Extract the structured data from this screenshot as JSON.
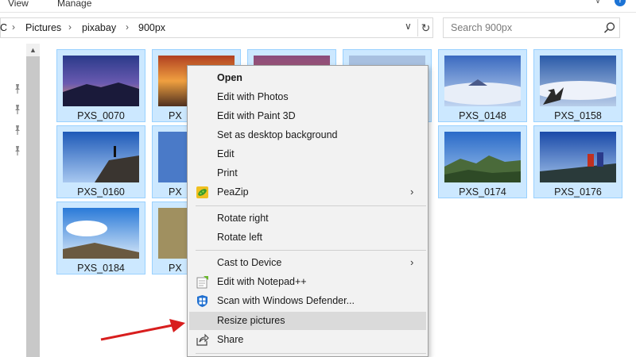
{
  "ribbon": {
    "tabs": [
      "View",
      "Manage"
    ]
  },
  "address": {
    "crumbs": [
      "C",
      "Pictures",
      "pixabay",
      "900px"
    ],
    "separator": "›"
  },
  "search": {
    "placeholder": "Search 900px"
  },
  "files": [
    {
      "label": "PXS_0070",
      "thumb": "sunset-mountain"
    },
    {
      "label": "PXS_0148",
      "thumb": "sea-of-clouds"
    },
    {
      "label": "PXS_0158",
      "thumb": "clouds-tree"
    },
    {
      "label": "PXS_0160",
      "thumb": "hiker-rock"
    },
    {
      "label": "PXS_0174",
      "thumb": "mountain-green"
    },
    {
      "label": "PXS_0176",
      "thumb": "hikers-summit"
    },
    {
      "label": "PXS_0184",
      "thumb": "sky-hill"
    }
  ],
  "partial_labels": [
    "PX",
    "PX",
    "PX"
  ],
  "context_menu": {
    "items": [
      {
        "label": "Open",
        "bold": true
      },
      {
        "label": "Edit with Photos"
      },
      {
        "label": "Edit with Paint 3D"
      },
      {
        "label": "Set as desktop background"
      },
      {
        "label": "Edit"
      },
      {
        "label": "Print"
      },
      {
        "label": "PeaZip",
        "icon": "peazip-icon",
        "submenu": true
      },
      {
        "label": "Rotate right"
      },
      {
        "label": "Rotate left"
      },
      {
        "label": "Cast to Device",
        "submenu": true
      },
      {
        "label": "Edit with Notepad++",
        "icon": "notepad-plus-plus-icon"
      },
      {
        "label": "Scan with Windows Defender...",
        "icon": "windows-defender-icon"
      },
      {
        "label": "Resize pictures",
        "highlighted": true
      },
      {
        "label": "Share",
        "icon": "share-icon"
      }
    ]
  },
  "colors": {
    "selection_bg": "#cce8ff",
    "selection_border": "#99d1ff",
    "menu_bg": "#f2f2f2",
    "menu_highlight": "#dadada",
    "arrow": "#d81e1e"
  }
}
